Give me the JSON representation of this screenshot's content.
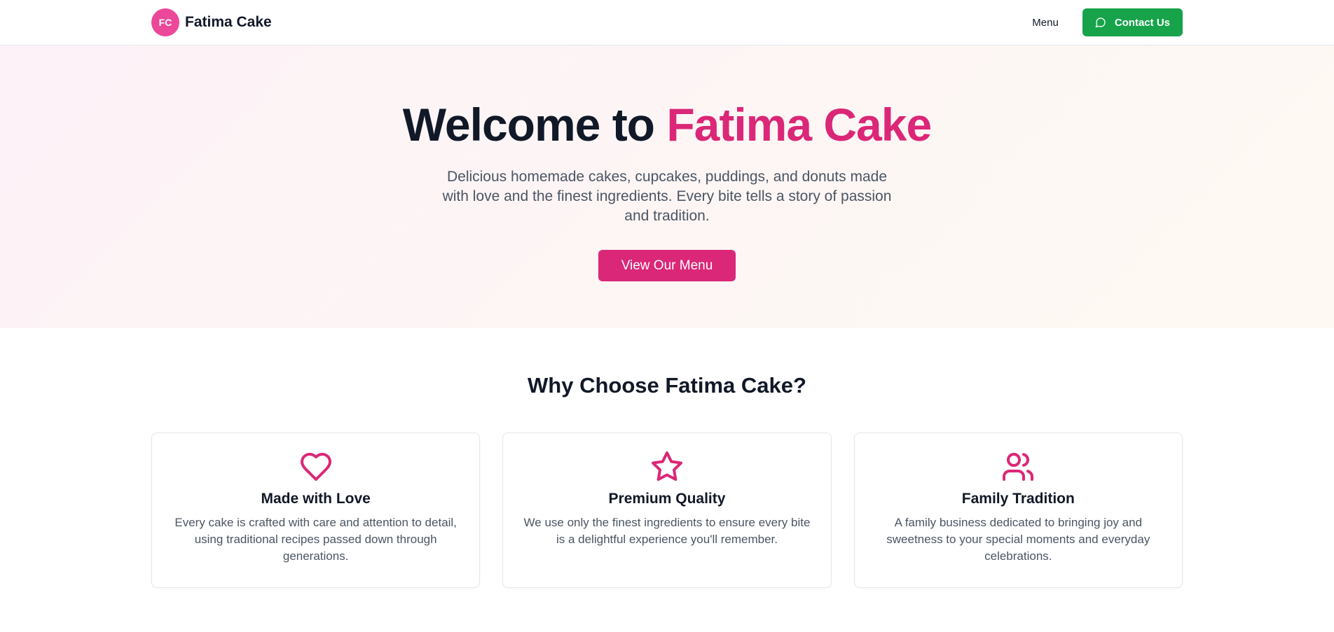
{
  "header": {
    "logo_initials": "FC",
    "brand_name": "Fatima Cake",
    "nav_menu": "Menu",
    "contact_label": "Contact Us"
  },
  "hero": {
    "title_prefix": "Welcome to ",
    "title_accent": "Fatima Cake",
    "subtitle": "Delicious homemade cakes, cupcakes, puddings, and donuts made with love and the finest ingredients. Every bite tells a story of passion and tradition.",
    "cta_label": "View Our Menu"
  },
  "features": {
    "title": "Why Choose Fatima Cake?",
    "cards": [
      {
        "icon": "heart-icon",
        "title": "Made with Love",
        "text": "Every cake is crafted with care and attention to detail, using traditional recipes passed down through generations."
      },
      {
        "icon": "star-icon",
        "title": "Premium Quality",
        "text": "We use only the finest ingredients to ensure every bite is a delightful experience you'll remember."
      },
      {
        "icon": "users-icon",
        "title": "Family Tradition",
        "text": "A family business dedicated to bringing joy and sweetness to your special moments and everyday celebrations."
      }
    ]
  },
  "colors": {
    "brand_pink": "#db2777",
    "logo_pink": "#ec4899",
    "contact_green": "#16a34a",
    "text_dark": "#111827",
    "text_muted": "#4b5563"
  }
}
